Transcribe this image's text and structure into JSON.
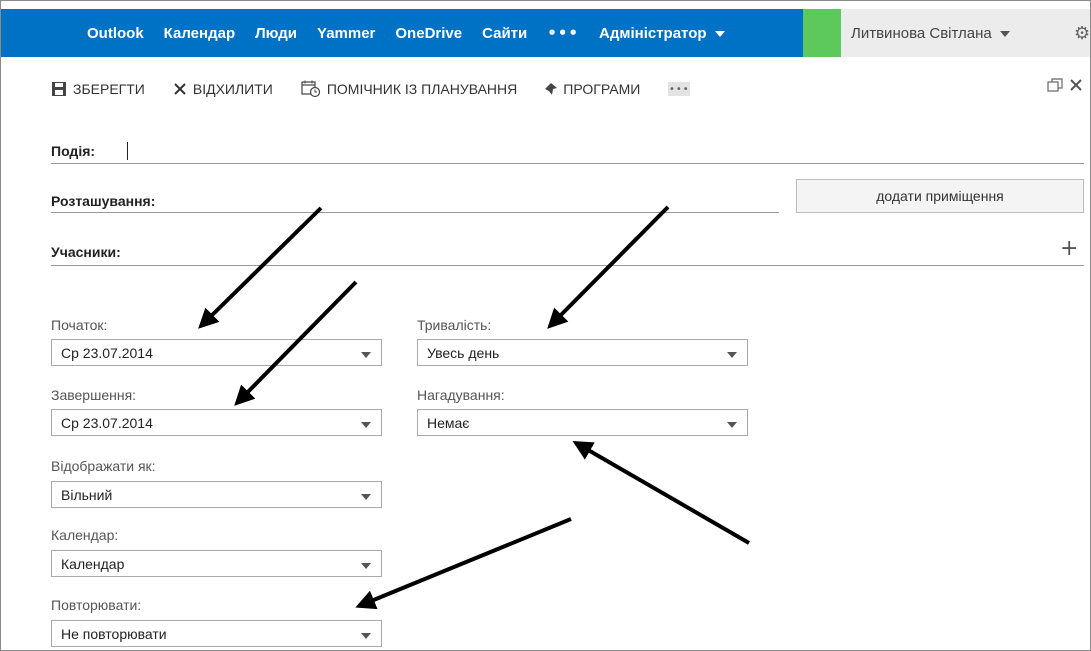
{
  "nav": {
    "items": [
      "Outlook",
      "Календар",
      "Люди",
      "Yammer",
      "OneDrive",
      "Сайти"
    ],
    "more": "•••",
    "admin": "Адміністратор"
  },
  "user": {
    "name": "Литвинова Світлана"
  },
  "toolbar": {
    "save": "ЗБЕРЕГТИ",
    "discard": "ВІДХИЛИТИ",
    "scheduling": "ПОМІЧНИК ІЗ ПЛАНУВАННЯ",
    "apps": "ПРОГРАМИ",
    "more": "•••"
  },
  "form": {
    "event_label": "Подія:",
    "event_value": "",
    "location_label": "Розташування:",
    "add_room": "додати приміщення",
    "attendees_label": "Учасники:",
    "add_icon": "+",
    "start_label": "Початок:",
    "start_value": "Ср 23.07.2014",
    "end_label": "Завершення:",
    "end_value": "Ср 23.07.2014",
    "duration_label": "Тривалість:",
    "duration_value": "Увесь день",
    "reminder_label": "Нагадування:",
    "reminder_value": "Немає",
    "show_as_label": "Відображати як:",
    "show_as_value": "Вільний",
    "calendar_label": "Календар:",
    "calendar_value": "Календар",
    "repeat_label": "Повторювати:",
    "repeat_value": "Не повторювати"
  },
  "colors": {
    "topbar": "#0072c6",
    "accent_green": "#5dc85b",
    "user_area": "#ececec"
  },
  "icons": [
    "save-icon",
    "close-icon",
    "calendar-clock-icon",
    "apps-icon",
    "more-icon",
    "gear-icon",
    "restore-window-icon",
    "close-window-icon",
    "plus-icon",
    "chevron-down-icon"
  ]
}
